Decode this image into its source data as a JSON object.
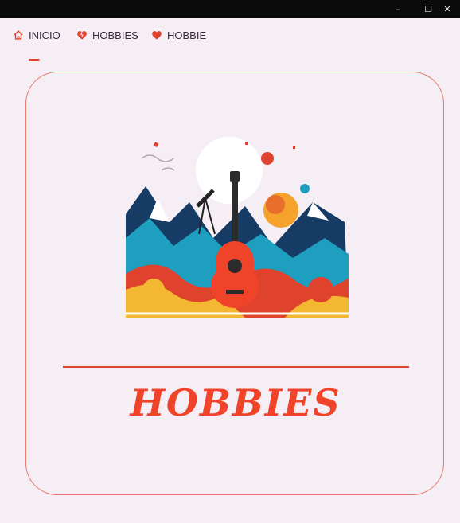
{
  "window": {
    "minimize_glyph": "–",
    "maximize_glyph": "☐",
    "close_glyph": "✕"
  },
  "nav": {
    "items": [
      {
        "label": "INICIO",
        "icon": "home-icon",
        "active": true
      },
      {
        "label": "HOBBIES",
        "icon": "broken-heart-icon",
        "active": false
      },
      {
        "label": "HOBBIE",
        "icon": "heart-icon",
        "active": false
      }
    ]
  },
  "card": {
    "image": "guitar-illustration",
    "title": "HOBBIES"
  },
  "colors": {
    "accent": "#e0432d",
    "background": "#f5eef5",
    "border": "#e87a6e",
    "titlebar": "#0b0b0b"
  }
}
